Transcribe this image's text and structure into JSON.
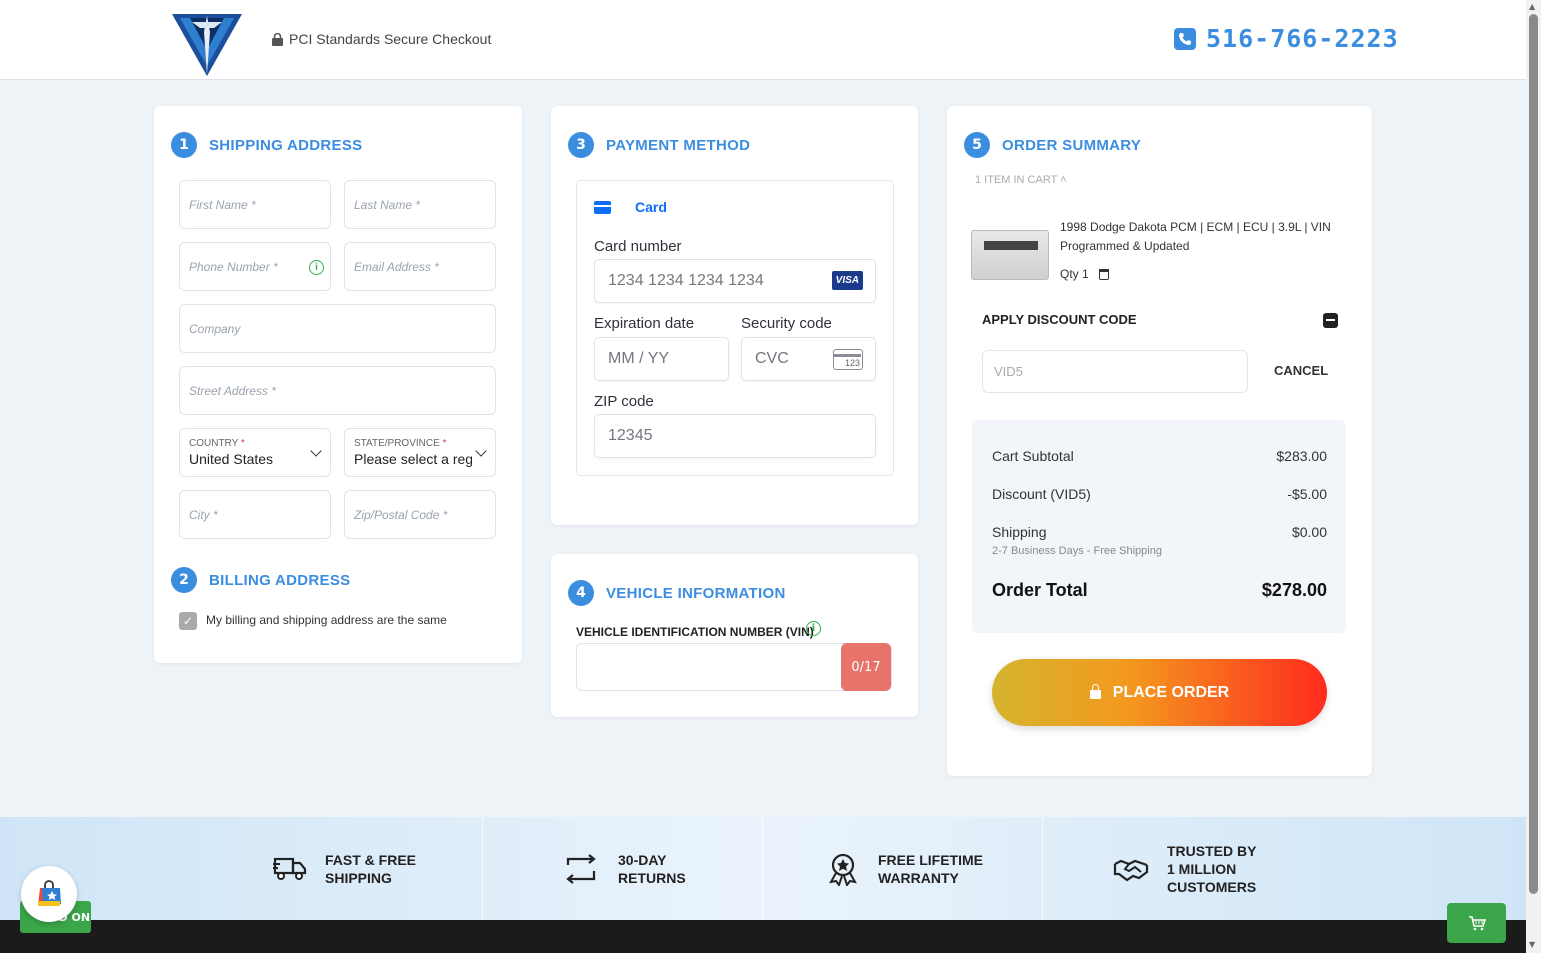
{
  "header": {
    "secure_text": "PCI Standards Secure Checkout",
    "phone": "516-766-2223"
  },
  "shipping": {
    "step": "1",
    "title": "SHIPPING ADDRESS",
    "first_name": "First Name *",
    "last_name": "Last Name *",
    "phone": "Phone Number *",
    "email": "Email Address *",
    "company": "Company",
    "street": "Street Address *",
    "country_label": "COUNTRY",
    "country_value": "United States",
    "state_label": "STATE/PROVINCE",
    "state_value": "Please select a region",
    "city": "City *",
    "zip": "Zip/Postal Code *"
  },
  "billing": {
    "step": "2",
    "title": "BILLING ADDRESS",
    "same_label": "My billing and shipping address are the same",
    "same_checked": true
  },
  "payment": {
    "step": "3",
    "title": "PAYMENT METHOD",
    "tab": "Card",
    "card_number_label": "Card number",
    "card_number_placeholder": "1234 1234 1234 1234",
    "card_brand": "VISA",
    "expiry_label": "Expiration date",
    "expiry_placeholder": "MM / YY",
    "cvc_label": "Security code",
    "cvc_placeholder": "CVC",
    "cvc_icon_text": "123",
    "zip_label": "ZIP code",
    "zip_value": "12345"
  },
  "vehicle": {
    "step": "4",
    "title": "VEHICLE INFORMATION",
    "vin_label": "VEHICLE IDENTIFICATION NUMBER (VIN)",
    "vin_counter": "0/17"
  },
  "summary": {
    "step": "5",
    "title": "ORDER SUMMARY",
    "cart_count": "1 ITEM IN CART",
    "product_name": "1998 Dodge Dakota PCM | ECM | ECU | 3.9L | VIN Programmed & Updated",
    "qty": "Qty 1",
    "discount_title": "APPLY DISCOUNT CODE",
    "discount_code": "VID5",
    "cancel": "CANCEL",
    "subtotal_label": "Cart Subtotal",
    "subtotal": "$283.00",
    "discount_label": "Discount (VID5)",
    "discount": "-$5.00",
    "shipping_label": "Shipping",
    "shipping": "$0.00",
    "shipping_note": "2-7 Business Days - Free Shipping",
    "total_label": "Order Total",
    "total": "$278.00",
    "place_order": "PLACE ORDER"
  },
  "features": [
    {
      "line1": "FAST & FREE",
      "line2": "SHIPPING",
      "icon": "truck-icon"
    },
    {
      "line1": "30-DAY",
      "line2": "RETURNS",
      "icon": "returns-icon"
    },
    {
      "line1": "FREE LIFETIME",
      "line2": "WARRANTY",
      "icon": "award-icon"
    },
    {
      "line1": "TRUSTED BY",
      "line2": "1 MILLION",
      "line3": "CUSTOMERS",
      "icon": "handshake-icon"
    }
  ],
  "widgets": {
    "addon_label": "ADD ON"
  },
  "colors": {
    "accent": "#3b8de0",
    "green": "#3ba54a",
    "vin_counter_bg": "#e8736b"
  }
}
